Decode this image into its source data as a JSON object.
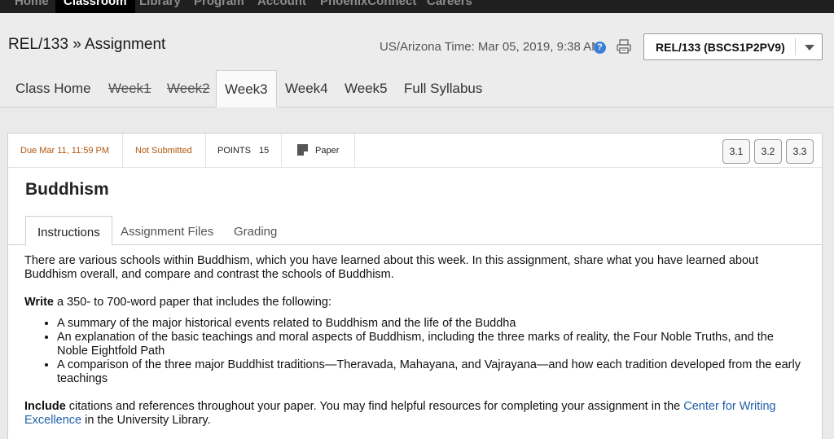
{
  "topnav": {
    "items": [
      "Home",
      "Classroom",
      "Library",
      "Program",
      "Account",
      "PhoenixConnect",
      "Careers"
    ]
  },
  "header": {
    "breadcrumb": "REL/133 » Assignment",
    "time": "US/Arizona Time: Mar 05, 2019, 9:38 AM",
    "course": "REL/133 (BSCS1P2PV9)"
  },
  "weektabs": [
    "Class Home",
    "Week1",
    "Week2",
    "Week3",
    "Week4",
    "Week5",
    "Full Syllabus"
  ],
  "assignment": {
    "due": "Due Mar 11, 11:59 PM",
    "status": "Not Submitted",
    "points_label": "POINTS",
    "points_value": "15",
    "type": "Paper",
    "objectives": [
      "3.1",
      "3.2",
      "3.3"
    ],
    "title": "Buddhism"
  },
  "subtabs": [
    "Instructions",
    "Assignment Files",
    "Grading"
  ],
  "instructions": {
    "intro": "There are various schools within Buddhism, which you have learned about this week. In this assignment, share what you have learned about Buddhism overall, and compare and contrast the schools of Buddhism.",
    "write_bold": "Write",
    "write_rest": " a 350- to 700-word paper that includes the following:",
    "bullets": [
      "A summary of the major historical events related to Buddhism and the life of the Buddha",
      "An explanation of the basic teachings and moral aspects of Buddhism, including the three marks of reality, the Four Noble Truths, and the Noble Eightfold Path",
      "A comparison of the three major Buddhist traditions—Theravada, Mahayana, and Vajrayana—and how each tradition developed from the early teachings"
    ],
    "include_bold": "Include",
    "include_rest": " citations and references throughout your paper. You may find helpful resources for completing your assignment in the ",
    "link": "Center for Writing Excellence",
    "include_end": " in the University Library."
  }
}
